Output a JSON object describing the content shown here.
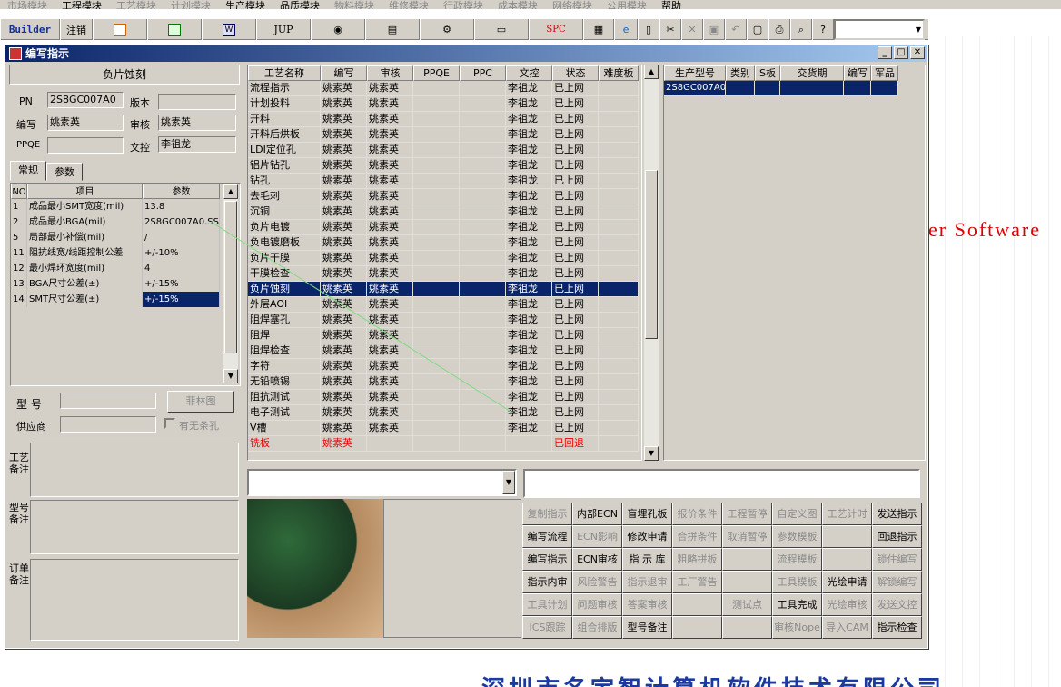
{
  "menubar": {
    "items": [
      "市场模块",
      "工程模块",
      "工艺模块",
      "计划模块",
      "生产模块",
      "品质模块",
      "物料模块",
      "维修模块",
      "行政模块",
      "成本模块",
      "网络模块",
      "公用模块",
      "帮助"
    ]
  },
  "toolbar": {
    "builder": "Builder",
    "logout": "注销",
    "jup": "JUP",
    "spc": "SPC"
  },
  "window": {
    "title": "编写指示"
  },
  "left": {
    "header": "负片蚀刻",
    "pn_label": "PN",
    "pn_value": "2S8GC007A0",
    "version_label": "版本",
    "version_value": "",
    "writer_label": "编写",
    "writer_value": "姚素英",
    "reviewer_label": "审核",
    "reviewer_value": "姚素英",
    "ppqe_label": "PPQE",
    "ppqe_value": "",
    "wenkong_label": "文控",
    "wenkong_value": "李祖龙",
    "tabs": [
      "常规",
      "参数"
    ],
    "param_headers": [
      "NO",
      "项目",
      "参数"
    ],
    "params": [
      {
        "no": "1",
        "item": "成品最小SMT宽度(mil)",
        "value": "13.8"
      },
      {
        "no": "2",
        "item": "成品最小BGA(mil)",
        "value": "2S8GC007A0.SS"
      },
      {
        "no": "5",
        "item": "局部最小补偿(mil)",
        "value": "/"
      },
      {
        "no": "11",
        "item": "阻抗线宽/线距控制公差",
        "value": "+/-10%"
      },
      {
        "no": "12",
        "item": "最小焊环宽度(mil)",
        "value": "4"
      },
      {
        "no": "13",
        "item": "BGA尺寸公差(±)",
        "value": "+/-15%"
      },
      {
        "no": "14",
        "item": "SMT尺寸公差(±)",
        "value": "+/-15%"
      }
    ],
    "model_label": "型 号",
    "model_value": "",
    "fei_button": "菲林图",
    "supplier_label": "供应商",
    "supplier_value": "",
    "no_strip_label": "有无条孔",
    "memo1_label": "工艺备注",
    "memo2_label": "型号备注",
    "memo3_label": "订单备注"
  },
  "grid": {
    "headers": [
      "工艺名称",
      "编写",
      "审核",
      "PPQE",
      "PPC",
      "文控",
      "状态",
      "难度板"
    ],
    "rows": [
      {
        "name": "流程指示",
        "writer": "姚素英",
        "reviewer": "姚素英",
        "ppqe": "",
        "ppc": "",
        "wenkong": "李祖龙",
        "status": "已上网",
        "diff": ""
      },
      {
        "name": "计划投料",
        "writer": "姚素英",
        "reviewer": "姚素英",
        "ppqe": "",
        "ppc": "",
        "wenkong": "李祖龙",
        "status": "已上网",
        "diff": ""
      },
      {
        "name": "开料",
        "writer": "姚素英",
        "reviewer": "姚素英",
        "ppqe": "",
        "ppc": "",
        "wenkong": "李祖龙",
        "status": "已上网",
        "diff": ""
      },
      {
        "name": "开料后烘板",
        "writer": "姚素英",
        "reviewer": "姚素英",
        "ppqe": "",
        "ppc": "",
        "wenkong": "李祖龙",
        "status": "已上网",
        "diff": ""
      },
      {
        "name": "LDI定位孔",
        "writer": "姚素英",
        "reviewer": "姚素英",
        "ppqe": "",
        "ppc": "",
        "wenkong": "李祖龙",
        "status": "已上网",
        "diff": ""
      },
      {
        "name": "铝片钻孔",
        "writer": "姚素英",
        "reviewer": "姚素英",
        "ppqe": "",
        "ppc": "",
        "wenkong": "李祖龙",
        "status": "已上网",
        "diff": ""
      },
      {
        "name": "钻孔",
        "writer": "姚素英",
        "reviewer": "姚素英",
        "ppqe": "",
        "ppc": "",
        "wenkong": "李祖龙",
        "status": "已上网",
        "diff": ""
      },
      {
        "name": "去毛刺",
        "writer": "姚素英",
        "reviewer": "姚素英",
        "ppqe": "",
        "ppc": "",
        "wenkong": "李祖龙",
        "status": "已上网",
        "diff": ""
      },
      {
        "name": "沉铜",
        "writer": "姚素英",
        "reviewer": "姚素英",
        "ppqe": "",
        "ppc": "",
        "wenkong": "李祖龙",
        "status": "已上网",
        "diff": ""
      },
      {
        "name": "负片电镀",
        "writer": "姚素英",
        "reviewer": "姚素英",
        "ppqe": "",
        "ppc": "",
        "wenkong": "李祖龙",
        "status": "已上网",
        "diff": ""
      },
      {
        "name": "负电镀磨板",
        "writer": "姚素英",
        "reviewer": "姚素英",
        "ppqe": "",
        "ppc": "",
        "wenkong": "李祖龙",
        "status": "已上网",
        "diff": ""
      },
      {
        "name": "负片干膜",
        "writer": "姚素英",
        "reviewer": "姚素英",
        "ppqe": "",
        "ppc": "",
        "wenkong": "李祖龙",
        "status": "已上网",
        "diff": ""
      },
      {
        "name": "干膜检查",
        "writer": "姚素英",
        "reviewer": "姚素英",
        "ppqe": "",
        "ppc": "",
        "wenkong": "李祖龙",
        "status": "已上网",
        "diff": ""
      },
      {
        "name": "负片蚀刻",
        "writer": "姚素英",
        "reviewer": "姚素英",
        "ppqe": "",
        "ppc": "",
        "wenkong": "李祖龙",
        "status": "已上网",
        "diff": "",
        "selected": true
      },
      {
        "name": "外层AOI",
        "writer": "姚素英",
        "reviewer": "姚素英",
        "ppqe": "",
        "ppc": "",
        "wenkong": "李祖龙",
        "status": "已上网",
        "diff": ""
      },
      {
        "name": "阻焊塞孔",
        "writer": "姚素英",
        "reviewer": "姚素英",
        "ppqe": "",
        "ppc": "",
        "wenkong": "李祖龙",
        "status": "已上网",
        "diff": ""
      },
      {
        "name": "阻焊",
        "writer": "姚素英",
        "reviewer": "姚素英",
        "ppqe": "",
        "ppc": "",
        "wenkong": "李祖龙",
        "status": "已上网",
        "diff": ""
      },
      {
        "name": "阻焊检查",
        "writer": "姚素英",
        "reviewer": "姚素英",
        "ppqe": "",
        "ppc": "",
        "wenkong": "李祖龙",
        "status": "已上网",
        "diff": ""
      },
      {
        "name": "字符",
        "writer": "姚素英",
        "reviewer": "姚素英",
        "ppqe": "",
        "ppc": "",
        "wenkong": "李祖龙",
        "status": "已上网",
        "diff": ""
      },
      {
        "name": "无铅喷锡",
        "writer": "姚素英",
        "reviewer": "姚素英",
        "ppqe": "",
        "ppc": "",
        "wenkong": "李祖龙",
        "status": "已上网",
        "diff": ""
      },
      {
        "name": "阻抗测试",
        "writer": "姚素英",
        "reviewer": "姚素英",
        "ppqe": "",
        "ppc": "",
        "wenkong": "李祖龙",
        "status": "已上网",
        "diff": ""
      },
      {
        "name": "电子测试",
        "writer": "姚素英",
        "reviewer": "姚素英",
        "ppqe": "",
        "ppc": "",
        "wenkong": "李祖龙",
        "status": "已上网",
        "diff": ""
      },
      {
        "name": "V槽",
        "writer": "姚素英",
        "reviewer": "姚素英",
        "ppqe": "",
        "ppc": "",
        "wenkong": "李祖龙",
        "status": "已上网",
        "diff": ""
      },
      {
        "name": "铣板",
        "writer": "姚素英",
        "reviewer": "",
        "ppqe": "",
        "ppc": "",
        "wenkong": "",
        "status": "已回退",
        "diff": "",
        "red": true
      }
    ]
  },
  "prod_grid": {
    "headers": [
      "生产型号",
      "类别",
      "S板",
      "交货期",
      "编写",
      "军品"
    ],
    "rows": [
      {
        "model": "2S8GC007A0",
        "type": "",
        "s": "",
        "date": "",
        "writer": "",
        "mil": ""
      }
    ]
  },
  "actions": [
    [
      {
        "t": "复制指示",
        "d": true
      },
      {
        "t": "内部ECN"
      },
      {
        "t": "盲埋孔板"
      },
      {
        "t": "报价条件",
        "d": true
      },
      {
        "t": "工程暂停",
        "d": true
      },
      {
        "t": "自定义图",
        "d": true
      },
      {
        "t": "工艺计时",
        "d": true
      },
      {
        "t": "发送指示"
      }
    ],
    [
      {
        "t": "编写流程"
      },
      {
        "t": "ECN影响",
        "d": true
      },
      {
        "t": "修改申请"
      },
      {
        "t": "合拼条件",
        "d": true
      },
      {
        "t": "取消暂停",
        "d": true
      },
      {
        "t": "参数模板",
        "d": true
      },
      {
        "t": ""
      },
      {
        "t": "回退指示"
      }
    ],
    [
      {
        "t": "编写指示"
      },
      {
        "t": "ECN审核"
      },
      {
        "t": "指 示 库"
      },
      {
        "t": "粗略拼板",
        "d": true
      },
      {
        "t": ""
      },
      {
        "t": "流程模板",
        "d": true
      },
      {
        "t": ""
      },
      {
        "t": "锁住编写",
        "d": true
      }
    ],
    [
      {
        "t": "指示内审"
      },
      {
        "t": "风险警告",
        "d": true
      },
      {
        "t": "指示退审",
        "d": true
      },
      {
        "t": "工厂警告",
        "d": true
      },
      {
        "t": ""
      },
      {
        "t": "工具模板",
        "d": true
      },
      {
        "t": "光绘申请"
      },
      {
        "t": "解锁编写",
        "d": true
      }
    ],
    [
      {
        "t": "工具计划",
        "d": true
      },
      {
        "t": "问题审核",
        "d": true
      },
      {
        "t": "答案审核",
        "d": true
      },
      {
        "t": ""
      },
      {
        "t": "测试点",
        "d": true
      },
      {
        "t": "工具完成"
      },
      {
        "t": "光绘审核",
        "d": true
      },
      {
        "t": "发送文控",
        "d": true
      }
    ],
    [
      {
        "t": "ICS跟踪",
        "d": true
      },
      {
        "t": "组合排版",
        "d": true
      },
      {
        "t": "型号备注"
      },
      {
        "t": ""
      },
      {
        "t": ""
      },
      {
        "t": "审核Nope",
        "d": true
      },
      {
        "t": "导入CAM",
        "d": true
      },
      {
        "t": "指示检查"
      }
    ]
  ],
  "background": {
    "software_text": "er Software",
    "company_text": "深圳市名宇智计算机软件技术有限公司"
  }
}
